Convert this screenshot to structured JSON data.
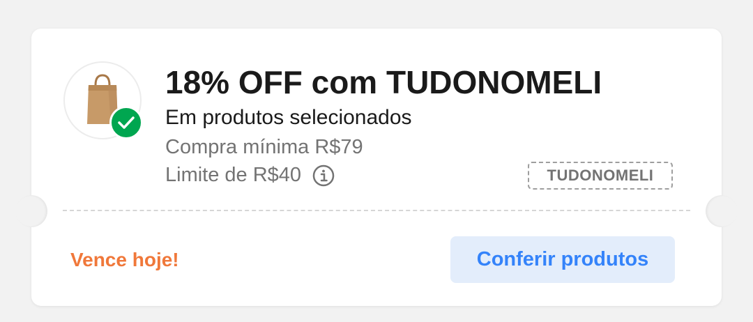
{
  "coupon": {
    "title": "18% OFF com TUDONOMELI",
    "subtitle": "Em produtos selecionados",
    "min_purchase": "Compra mínima R$79",
    "limit": "Limite de R$40",
    "code": "TUDONOMELI",
    "expires": "Vence hoje!",
    "cta_label": "Conferir produtos",
    "thumbnail_icon": "shopping-bag-icon",
    "badge_icon": "check-icon",
    "info_icon": "info-icon",
    "applied": true
  },
  "colors": {
    "background": "#f2f2f2",
    "card": "#ffffff",
    "title": "#1a1a1a",
    "secondary_text": "#737373",
    "expires": "#f0783a",
    "cta_text": "#3483fa",
    "cta_background": "#e3edfb",
    "check_badge": "#00a650"
  }
}
